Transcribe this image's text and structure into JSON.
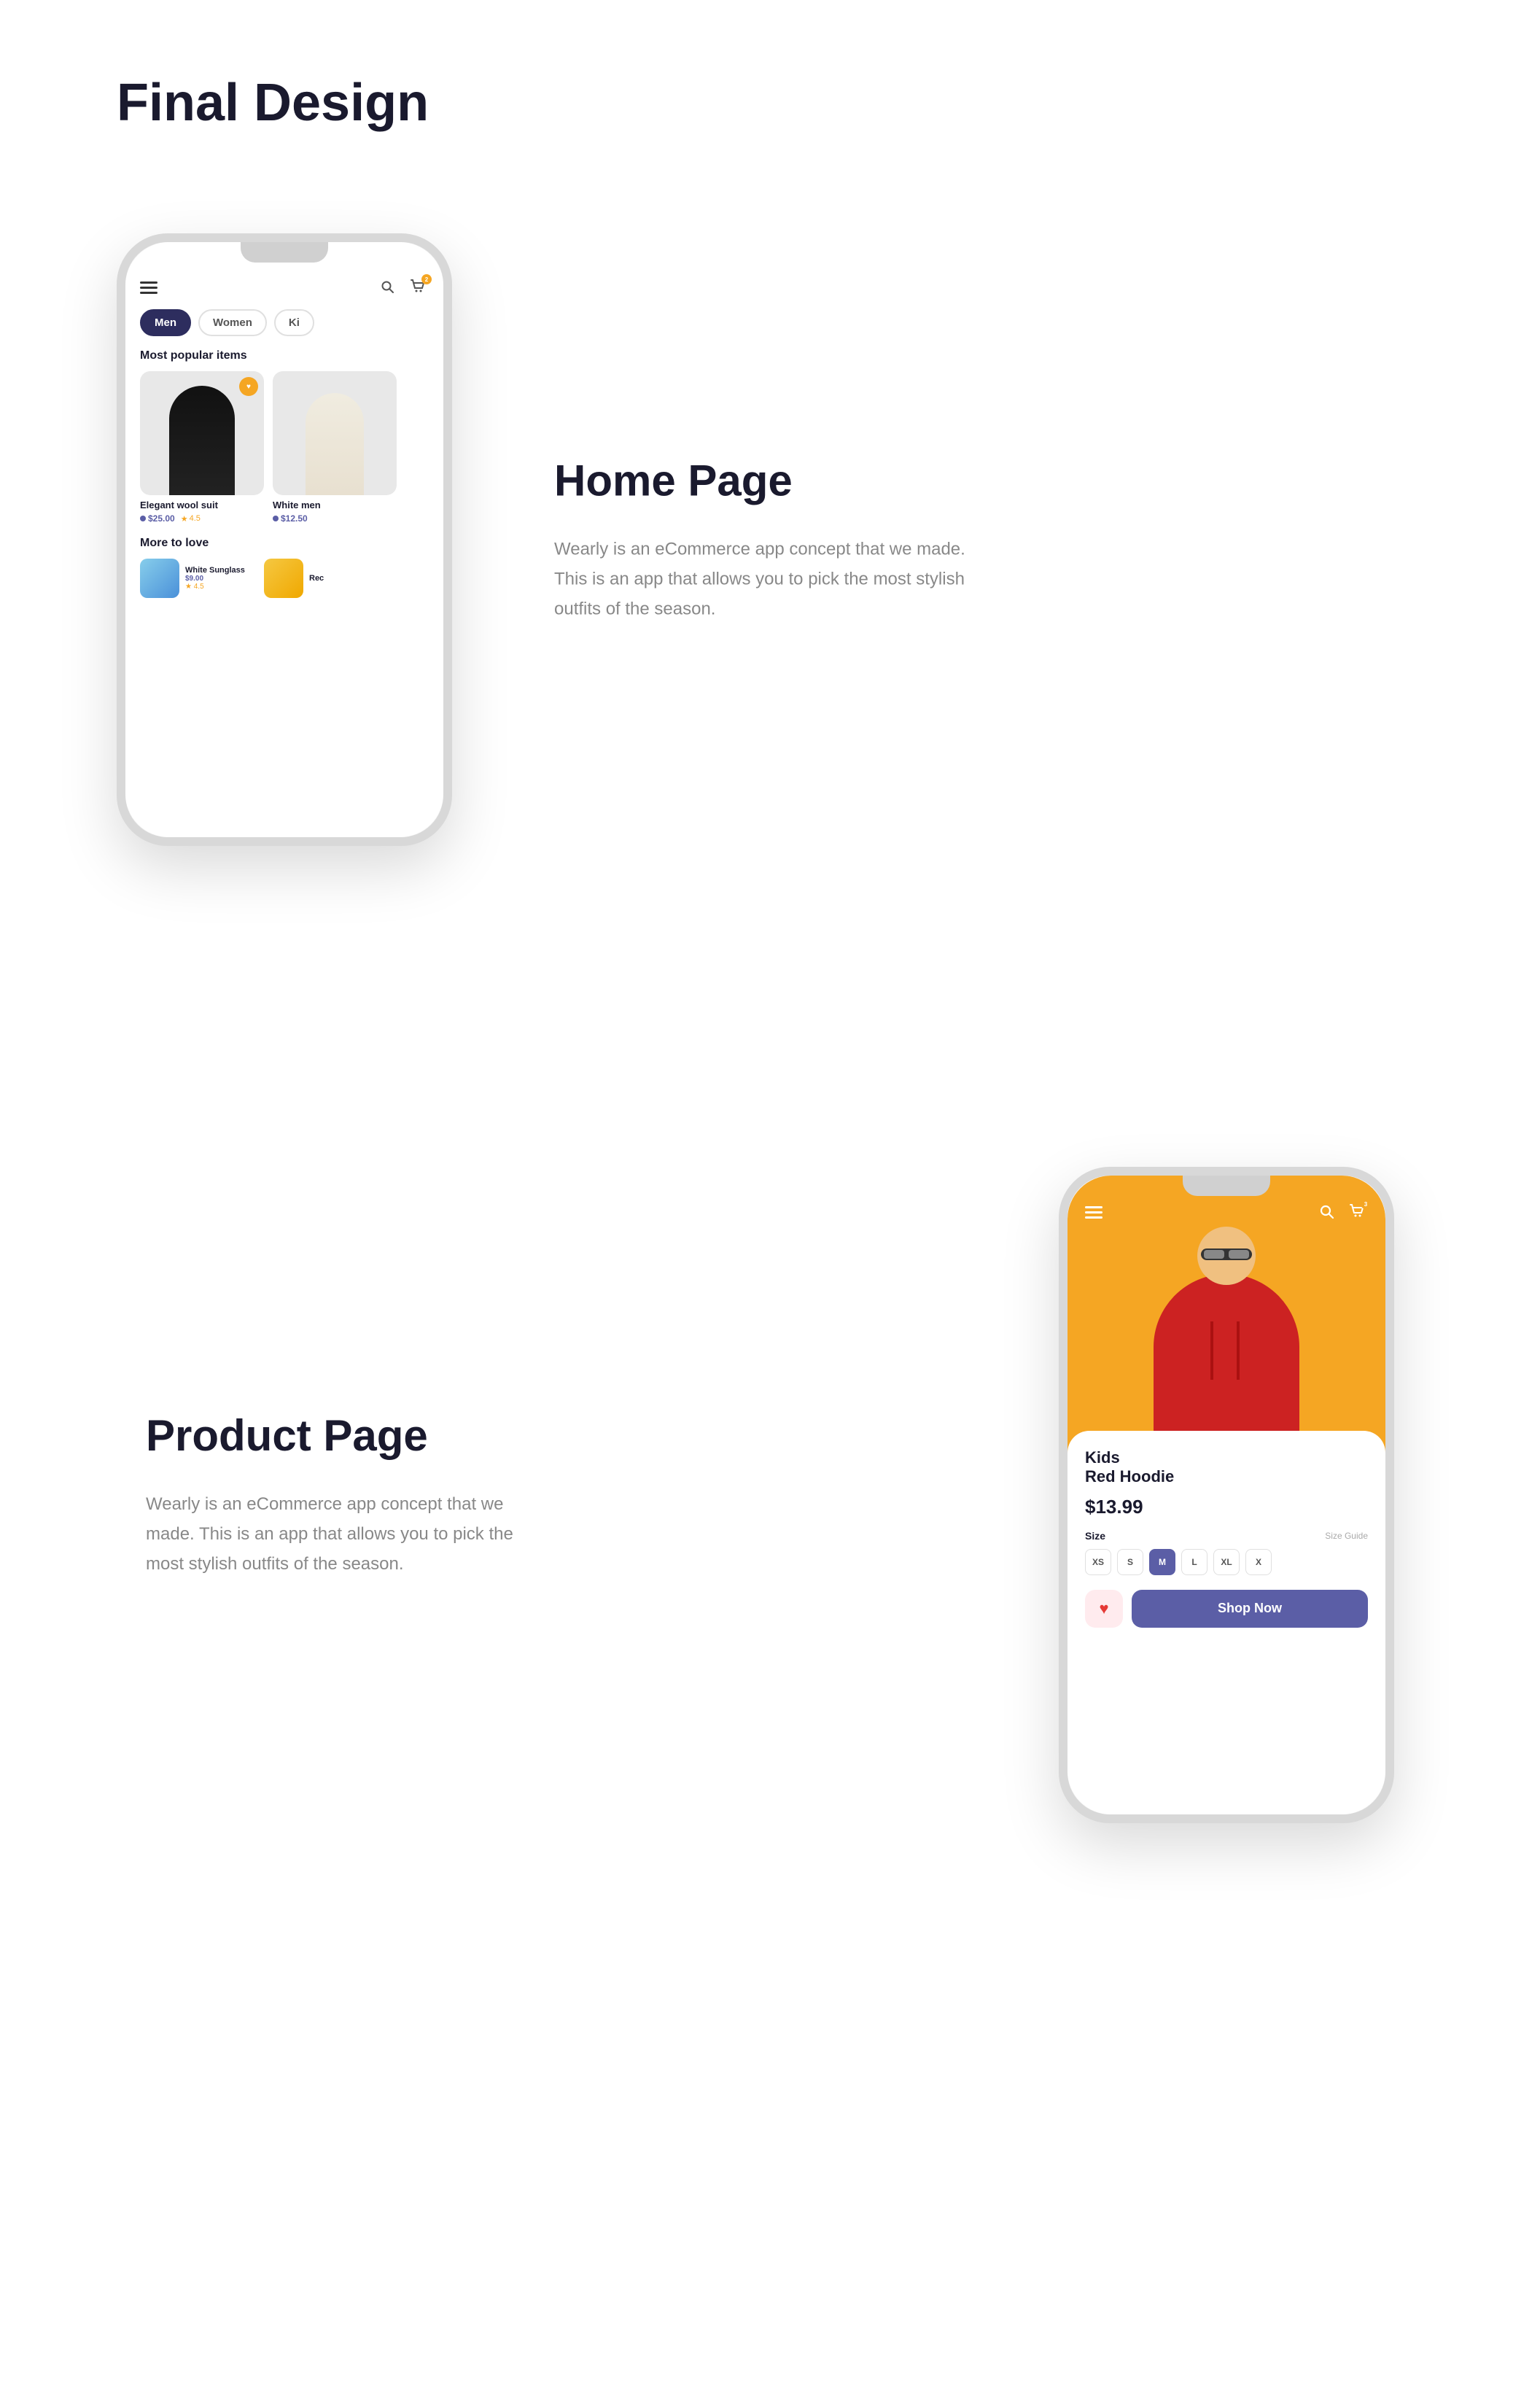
{
  "page": {
    "title": "Final Design"
  },
  "section_home": {
    "title": "Home Page",
    "description": "Wearly is an eCommerce app concept that we made. This is an app that allows you to pick the most stylish outfits of the season.",
    "phone": {
      "categories": [
        "Men",
        "Women",
        "Ki"
      ],
      "active_category": "Men",
      "section1_label": "Most popular items",
      "products": [
        {
          "name": "Elegant wool suit",
          "price": "$25.00",
          "rating": "4.5"
        },
        {
          "name": "White men",
          "price": "$12.50",
          "rating": ""
        }
      ],
      "section2_label": "More to love",
      "love_items": [
        {
          "name": "White Sunglass",
          "price": "$9.00",
          "rating": "4.5"
        },
        {
          "name": "Rec",
          "price": "$",
          "rating": ""
        }
      ],
      "cart_badge": "2"
    }
  },
  "section_product": {
    "title": "Product Page",
    "description": "Wearly is an eCommerce app concept that we made. This is an app that allows you to pick the most stylish outfits of the season.",
    "phone": {
      "product_name": "Kids\nRed Hoodie",
      "product_name_line1": "Kids",
      "product_name_line2": "Red Hoodie",
      "price": "$13.99",
      "size_label": "Size",
      "size_guide_label": "Size Guide",
      "sizes": [
        "XS",
        "S",
        "M",
        "L",
        "XL",
        "X"
      ],
      "selected_size": "M",
      "shop_now_label": "Shop Now",
      "cart_badge": "3",
      "heart_icon": "♥"
    }
  }
}
